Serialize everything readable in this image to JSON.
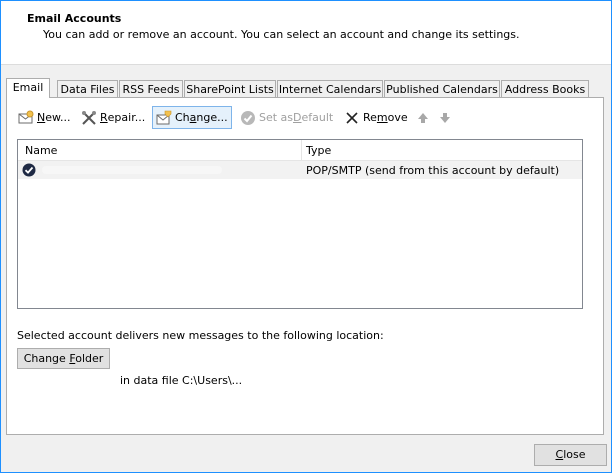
{
  "header": {
    "title": "Email Accounts",
    "subtitle": "You can add or remove an account. You can select an account and change its settings."
  },
  "tabs": [
    {
      "label": "Email"
    },
    {
      "label": "Data Files"
    },
    {
      "label": "RSS Feeds"
    },
    {
      "label": "SharePoint Lists"
    },
    {
      "label": "Internet Calendars"
    },
    {
      "label": "Published Calendars"
    },
    {
      "label": "Address Books"
    }
  ],
  "toolbar": {
    "new": {
      "pre": "",
      "key": "N",
      "post": "ew..."
    },
    "repair": {
      "pre": "",
      "key": "R",
      "post": "epair..."
    },
    "change": {
      "pre": "Ch",
      "key": "a",
      "post": "nge..."
    },
    "set_default": {
      "pre": "Set as ",
      "key": "D",
      "post": "efault"
    },
    "remove": {
      "pre": "Re",
      "key": "m",
      "post": "ove"
    }
  },
  "list": {
    "columns": {
      "name": "Name",
      "type": "Type"
    },
    "rows": [
      {
        "type": "POP/SMTP (send from this account by default)"
      }
    ]
  },
  "delivery": {
    "label": "Selected account delivers new messages to the following location:",
    "change_folder": {
      "pre": "Change ",
      "key": "F",
      "post": "older"
    },
    "data_file": "in data file C:\\Users\\..."
  },
  "footer": {
    "close": {
      "pre": "",
      "key": "C",
      "post": "lose"
    }
  }
}
